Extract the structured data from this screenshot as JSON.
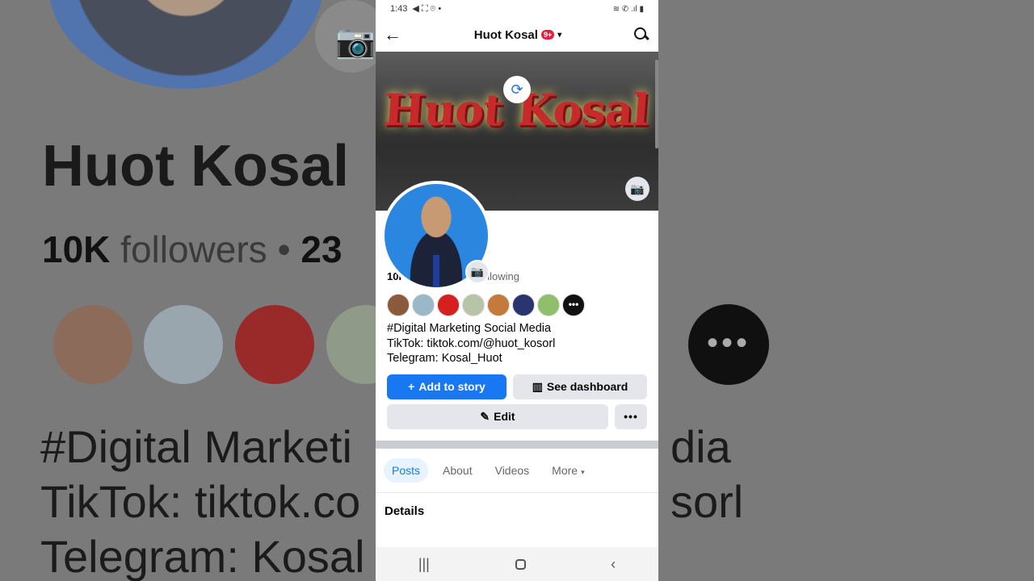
{
  "background": {
    "name": "Huot Kosal",
    "followers_count": "10K",
    "followers_label": "followers",
    "dot": "•",
    "following_count": "23",
    "bio_left": "#Digital Marketi\nTikTok: tiktok.co\nTelegram: Kosal",
    "bio_right": "dia\nsorl"
  },
  "status_bar": {
    "time": "1:43",
    "left_icons": "◀ ⛶ ⌾ •",
    "right_icons": "≋ ✆ .ıl ▮"
  },
  "header": {
    "back_icon": "←",
    "title": "Huot Kosal",
    "badge": "9+",
    "caret": "▾"
  },
  "cover": {
    "text": "Huot Kosal",
    "refresh_icon": "⟳",
    "camera_icon": "📷"
  },
  "profile": {
    "avatar_camera_icon": "📷",
    "name": "Huot Kosal",
    "followers_count": "10K",
    "followers_label": "followers",
    "dot": "•",
    "following_count": "23",
    "following_label": "following",
    "friend_colors": [
      "#8b5a3c",
      "#9bb8c9",
      "#d62020",
      "#b8c4a8",
      "#c47a3a",
      "#2a3570",
      "#8fbf6a"
    ],
    "more_friends": "•••",
    "bio_line1": "#Digital Marketing Social Media",
    "bio_line2": "TikTok: tiktok.com/@huot_kosorl",
    "bio_line3": "Telegram: Kosal_Huot"
  },
  "actions": {
    "add_story_icon": "+",
    "add_story": "Add to story",
    "dashboard_icon": "▥",
    "dashboard": "See dashboard",
    "edit_icon": "✎",
    "edit": "Edit",
    "more": "•••"
  },
  "tabs": [
    {
      "label": "Posts",
      "active": true
    },
    {
      "label": "About"
    },
    {
      "label": "Videos"
    },
    {
      "label": "More",
      "caret": "▾"
    }
  ],
  "details": {
    "title": "Details"
  },
  "navbar": {
    "recent": "|||",
    "back": "‹"
  },
  "colors": {
    "accent": "#1877f2",
    "badge": "#e41e3f",
    "cover_text": "#c62a2a"
  }
}
